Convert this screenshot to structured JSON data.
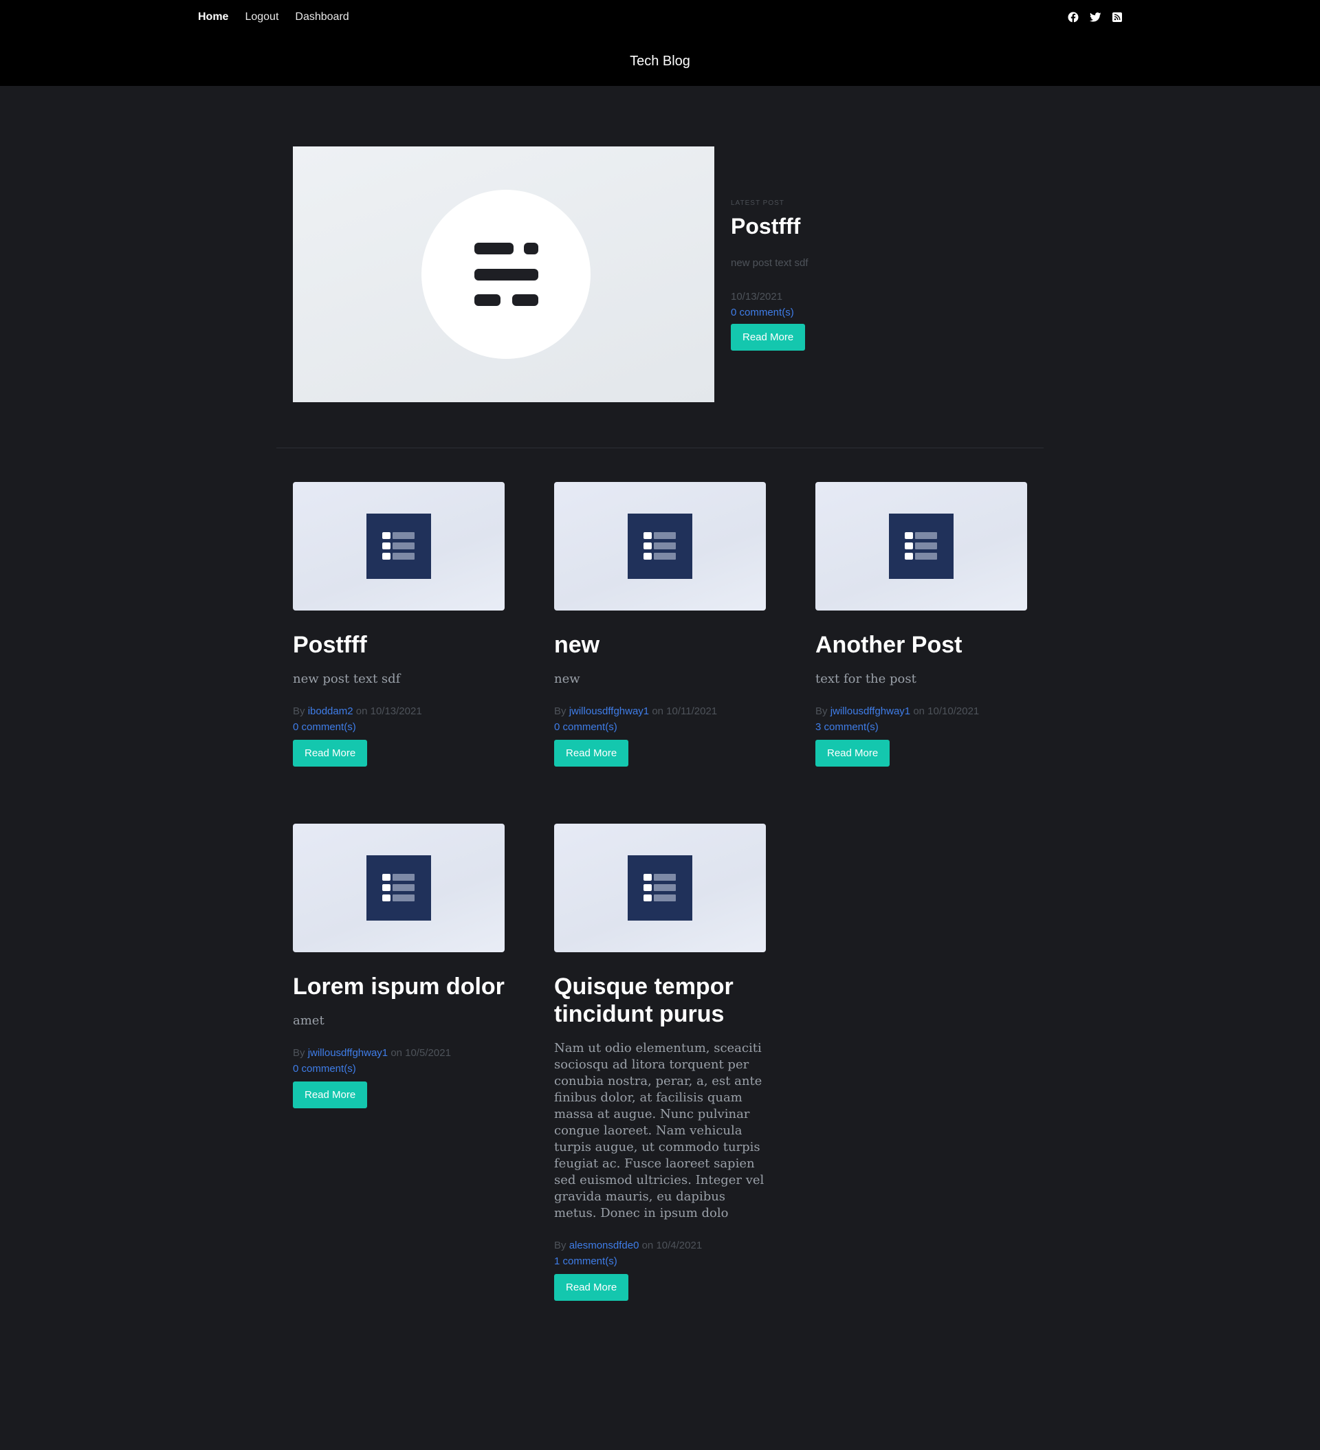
{
  "nav": {
    "links": [
      "Home",
      "Logout",
      "Dashboard"
    ],
    "brand": "Tech Blog",
    "social": [
      "facebook-icon",
      "twitter-icon",
      "rss-icon"
    ]
  },
  "featured": {
    "eyebrow": "LATEST POST",
    "title": "Postfff",
    "body": "new post text sdf",
    "date": "10/13/2021",
    "comments": "0 comment(s)",
    "button": "Read More"
  },
  "posts": [
    {
      "title": "Postfff",
      "excerpt": "new post text sdf",
      "by": "By",
      "author": "iboddam2",
      "on": "on 10/13/2021",
      "comments": "0 comment(s)",
      "button": "Read More"
    },
    {
      "title": "new",
      "excerpt": "new",
      "by": "By",
      "author": "jwillousdffghway1",
      "on": "on 10/11/2021",
      "comments": "0 comment(s)",
      "button": "Read More"
    },
    {
      "title": "Another Post",
      "excerpt": "text for the post",
      "by": "By",
      "author": "jwillousdffghway1",
      "on": "on 10/10/2021",
      "comments": "3 comment(s)",
      "button": "Read More"
    },
    {
      "title": "Lorem ispum dolor",
      "excerpt": "amet",
      "by": "By",
      "author": "jwillousdffghway1",
      "on": "on 10/5/2021",
      "comments": "0 comment(s)",
      "button": "Read More"
    },
    {
      "title": "Quisque tempor tincidunt purus",
      "excerpt": "Nam ut odio elementum, sceaciti sociosqu ad litora torquent per conubia nostra, perar, a, est ante finibus dolor, at facilisis quam massa at augue. Nunc pulvinar congue laoreet. Nam vehicula turpis augue, ut commodo turpis feugiat ac. Fusce laoreet sapien sed euismod ultricies. Integer vel gravida mauris, eu dapibus metus. Donec in ipsum dolo",
      "by": "By",
      "author": "alesmonsdfde0",
      "on": "on 10/4/2021",
      "comments": "1 comment(s)",
      "button": "Read More"
    }
  ],
  "colors": {
    "background": "#1a1b1f",
    "header": "#000000",
    "accent_button": "#14c7ae",
    "link": "#3f7de8",
    "thumb_square": "#20315a"
  }
}
